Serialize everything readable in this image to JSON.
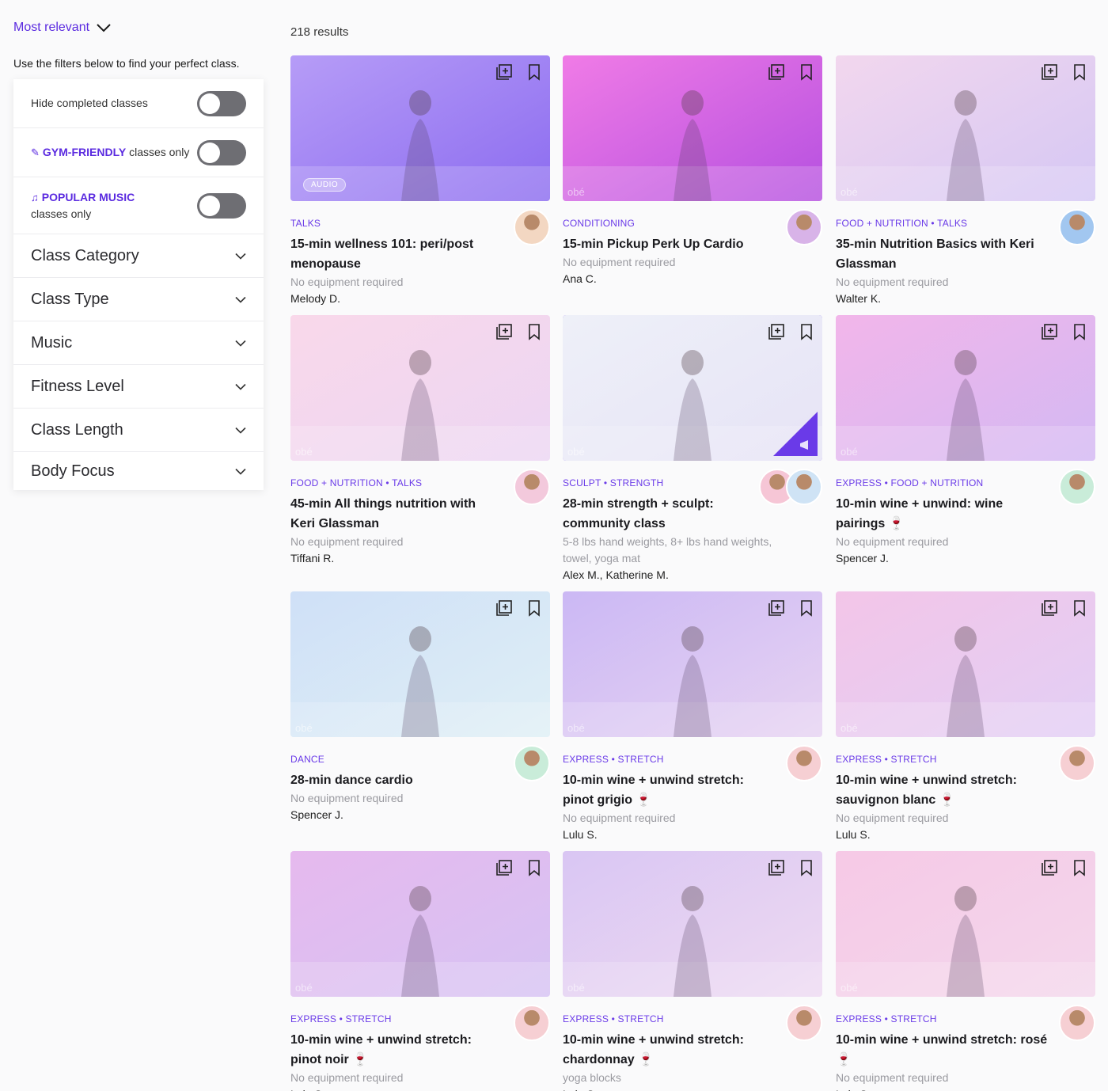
{
  "sort": {
    "label": "Most relevant"
  },
  "filters_hint": "Use the filters below to find your perfect class.",
  "toggles": {
    "hide_completed": "Hide completed classes",
    "gym_friendly_accent": "GYM-FRIENDLY",
    "gym_friendly_rest": " classes only",
    "popular_music_accent": "POPULAR MUSIC",
    "popular_music_rest": "classes only"
  },
  "accordions": [
    "Class Category",
    "Class Type",
    "Music",
    "Fitness Level",
    "Class Length",
    "Body Focus"
  ],
  "results_count": "218 results",
  "thumb_watermark": "obé",
  "audio_badge": "AUDIO",
  "cards": [
    {
      "category": "TALKS",
      "title": "15-min wellness 101: peri/post menopause",
      "equipment": "No equipment required",
      "instructor": "Melody D.",
      "thumb": [
        "#b69cf7",
        "#8c6cf0"
      ],
      "avatars": [
        "#f3d7c2"
      ]
    },
    {
      "category": "CONDITIONING",
      "title": "15-min Pickup Perk Up Cardio",
      "equipment": "No equipment required",
      "instructor": "Ana C.",
      "thumb": [
        "#f07be6",
        "#b550e0"
      ],
      "avatars": [
        "#d8b3e8"
      ]
    },
    {
      "category": "FOOD + NUTRITION • TALKS",
      "title": "35-min Nutrition Basics with Keri Glassman",
      "equipment": "No equipment required",
      "instructor": "Walter K.",
      "thumb": [
        "#f2d7ee",
        "#d5c7f4"
      ],
      "avatars": [
        "#a2c7f0"
      ]
    },
    {
      "category": "FOOD + NUTRITION • TALKS",
      "title": "45-min All things nutrition with Keri Glassman",
      "equipment": "No equipment required",
      "instructor": "Tiffani R.",
      "thumb": [
        "#f9d8ea",
        "#ecd6f3"
      ],
      "avatars": [
        "#f3c9dc"
      ]
    },
    {
      "category": "SCULPT • STRENGTH",
      "title": "28-min strength + sculpt: community class",
      "equipment": "5-8 lbs hand weights, 8+ lbs hand weights, towel, yoga mat",
      "instructor": "Alex M., Katherine M.",
      "thumb": [
        "#eef0f8",
        "#e6e3f6"
      ],
      "avatars": [
        "#f6c6d6",
        "#cfe3f5"
      ]
    },
    {
      "category": "EXPRESS • FOOD + NUTRITION",
      "title": "10-min wine + unwind: wine pairings 🍷",
      "equipment": "No equipment required",
      "instructor": "Spencer J.",
      "thumb": [
        "#f2b6ea",
        "#d3b8f3"
      ],
      "avatars": [
        "#c9ecd9"
      ]
    },
    {
      "category": "DANCE",
      "title": "28-min dance cardio",
      "equipment": "No equipment required",
      "instructor": "Spencer J.",
      "thumb": [
        "#cfe0f7",
        "#dfeff6"
      ],
      "avatars": [
        "#c9ecd9"
      ]
    },
    {
      "category": "EXPRESS • STRETCH",
      "title": "10-min wine + unwind stretch: pinot grigio 🍷",
      "equipment": "No equipment required",
      "instructor": "Lulu S.",
      "thumb": [
        "#cbb8f4",
        "#e7d3f2"
      ],
      "avatars": [
        "#f6cfd3"
      ]
    },
    {
      "category": "EXPRESS • STRETCH",
      "title": "10-min wine + unwind stretch: sauvignon blanc 🍷",
      "equipment": "No equipment required",
      "instructor": "Lulu S.",
      "thumb": [
        "#f3c5e8",
        "#e2cff5"
      ],
      "avatars": [
        "#f6cfd3"
      ]
    },
    {
      "category": "EXPRESS • STRETCH",
      "title": "10-min wine + unwind stretch: pinot noir 🍷",
      "equipment": "No equipment required",
      "instructor": "Lulu S.",
      "thumb": [
        "#e6b9ee",
        "#d6c3f3"
      ],
      "avatars": [
        "#f6cfd3"
      ]
    },
    {
      "category": "EXPRESS • STRETCH",
      "title": "10-min wine + unwind stretch: chardonnay 🍷",
      "equipment": "yoga blocks",
      "instructor": "Lulu S.",
      "thumb": [
        "#d9c6f3",
        "#eedaf2"
      ],
      "avatars": [
        "#f6cfd3"
      ]
    },
    {
      "category": "EXPRESS • STRETCH",
      "title": "10-min wine + unwind stretch: rosé 🍷",
      "equipment": "No equipment required",
      "instructor": "Lulu S.",
      "thumb": [
        "#f6c9e6",
        "#f3d7ec"
      ],
      "avatars": [
        "#f6cfd3"
      ]
    }
  ]
}
